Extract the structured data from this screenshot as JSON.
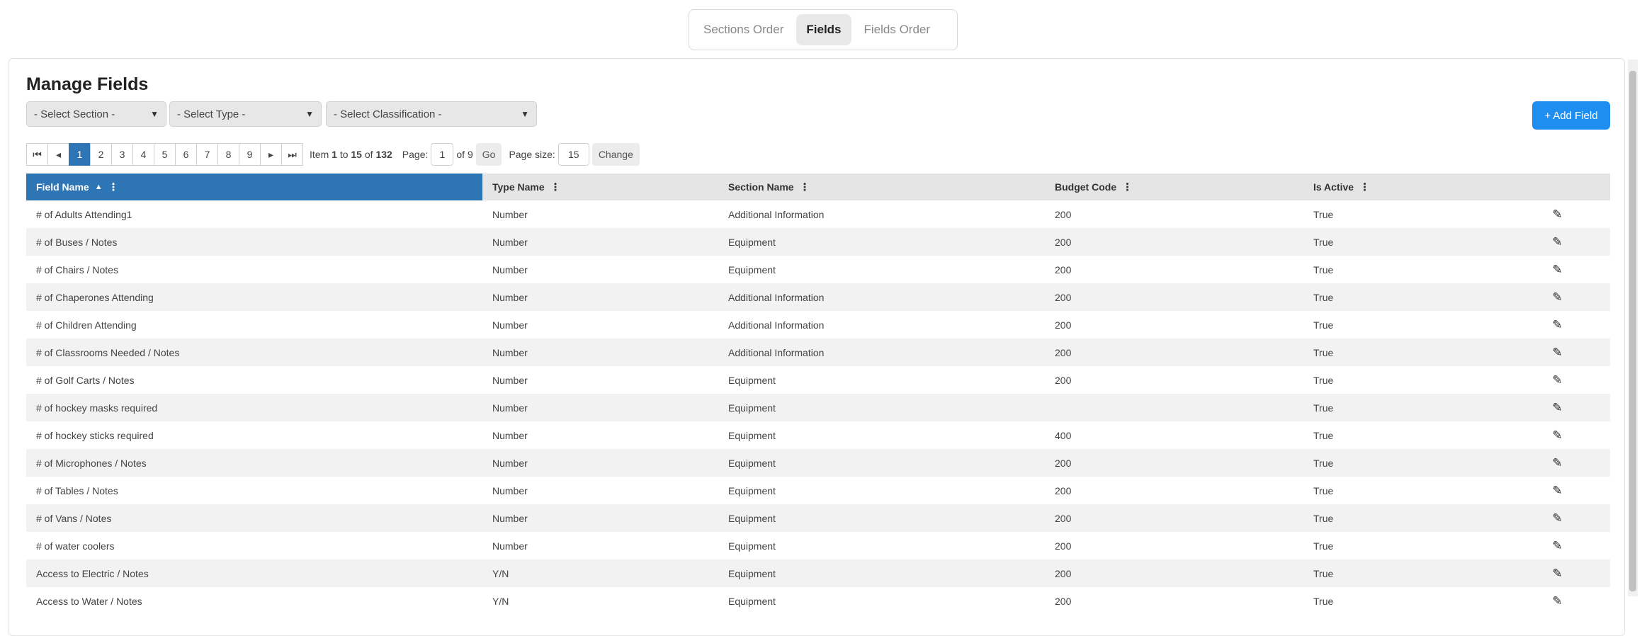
{
  "tabs": [
    {
      "label": "Sections Order",
      "active": false
    },
    {
      "label": "Fields",
      "active": true
    },
    {
      "label": "Fields Order",
      "active": false
    }
  ],
  "page_title": "Manage Fields",
  "filters": {
    "section": "- Select Section -",
    "type": "- Select Type -",
    "classification": "- Select Classification -"
  },
  "add_button": {
    "icon": "+",
    "label": "Add Field"
  },
  "pager": {
    "first_icon": "⏮",
    "prev_icon": "◂",
    "next_icon": "▸",
    "last_icon": "⏭",
    "pages": [
      "1",
      "2",
      "3",
      "4",
      "5",
      "6",
      "7",
      "8",
      "9"
    ],
    "current_page_index": 0,
    "item_word": "Item",
    "item_from": "1",
    "to_word": "to",
    "item_to": "15",
    "of_word": "of",
    "total": "132",
    "page_label": "Page:",
    "page_value": "1",
    "of_pages": "of 9",
    "go_label": "Go",
    "page_size_label": "Page size:",
    "page_size_value": "15",
    "change_label": "Change"
  },
  "table": {
    "headers": [
      "Field Name",
      "Type Name",
      "Section Name",
      "Budget Code",
      "Is Active"
    ],
    "sort_indicator": "▲",
    "menu_icon": "⋮",
    "edit_icon": "✎",
    "rows": [
      [
        "# of Adults Attending1",
        "Number",
        "Additional Information",
        "200",
        "True"
      ],
      [
        "# of Buses / Notes",
        "Number",
        "Equipment",
        "200",
        "True"
      ],
      [
        "# of Chairs / Notes",
        "Number",
        "Equipment",
        "200",
        "True"
      ],
      [
        "# of Chaperones Attending",
        "Number",
        "Additional Information",
        "200",
        "True"
      ],
      [
        "# of Children Attending",
        "Number",
        "Additional Information",
        "200",
        "True"
      ],
      [
        "# of Classrooms Needed / Notes",
        "Number",
        "Additional Information",
        "200",
        "True"
      ],
      [
        "# of Golf Carts / Notes",
        "Number",
        "Equipment",
        "200",
        "True"
      ],
      [
        "# of hockey masks required",
        "Number",
        "Equipment",
        "",
        "True"
      ],
      [
        "# of hockey sticks required",
        "Number",
        "Equipment",
        "400",
        "True"
      ],
      [
        "# of Microphones / Notes",
        "Number",
        "Equipment",
        "200",
        "True"
      ],
      [
        "# of Tables / Notes",
        "Number",
        "Equipment",
        "200",
        "True"
      ],
      [
        "# of Vans / Notes",
        "Number",
        "Equipment",
        "200",
        "True"
      ],
      [
        "# of water coolers",
        "Number",
        "Equipment",
        "200",
        "True"
      ],
      [
        "Access to Electric / Notes",
        "Y/N",
        "Equipment",
        "200",
        "True"
      ],
      [
        "Access to Water / Notes",
        "Y/N",
        "Equipment",
        "200",
        "True"
      ]
    ]
  },
  "colors": {
    "accent": "#2e75b6",
    "button": "#1f8ef1"
  }
}
